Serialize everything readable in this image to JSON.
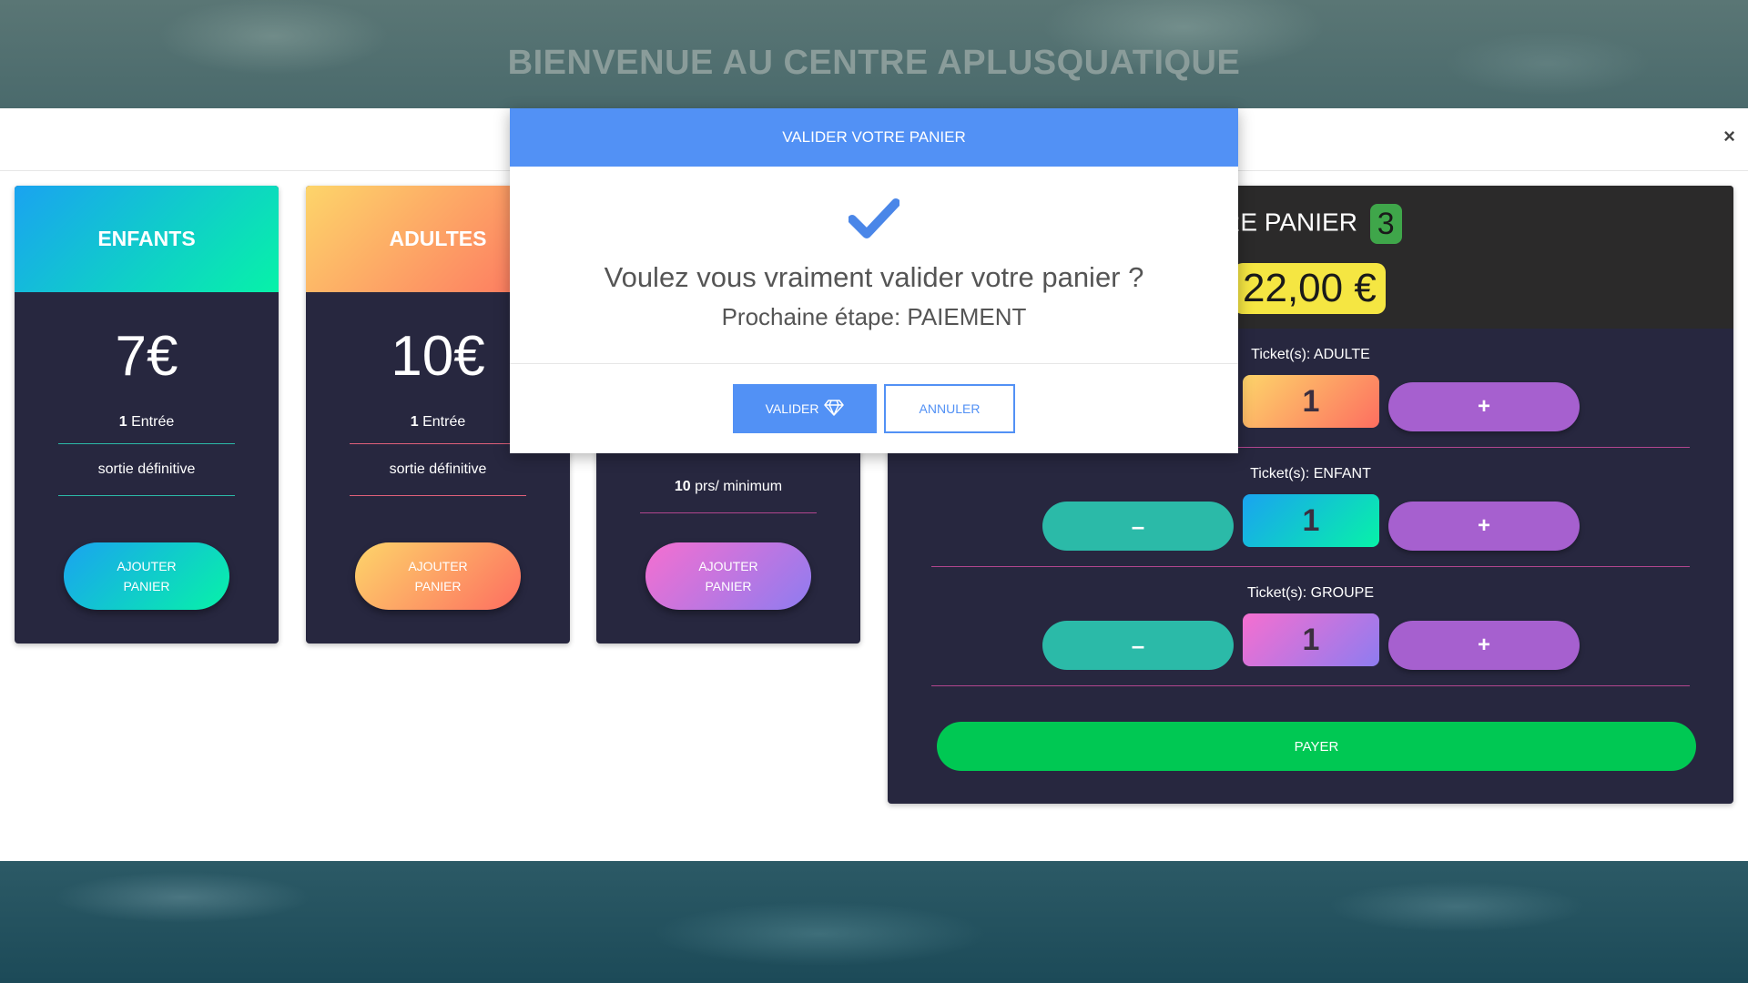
{
  "site": {
    "title": "BIENVENUE AU CENTRE APLUSQUATIQUE"
  },
  "modal": {
    "close_label": "×"
  },
  "cards": [
    {
      "title": "ENFANTS",
      "price": "7€",
      "line1_bold": "1",
      "line1_rest": " Entrée",
      "line2": "sortie définitive",
      "button": "AJOUTER PANIER"
    },
    {
      "title": "ADULTES",
      "price": "10€",
      "line1_bold": "1",
      "line1_rest": " Entrée",
      "line2": "sortie définitive",
      "button": "AJOUTER PANIER"
    },
    {
      "title": "",
      "price": "",
      "line1_bold": "",
      "line1_rest": "",
      "line2_bold": "10",
      "line2_rest": " prs/ minimum",
      "button": "AJOUTER PANIER"
    }
  ],
  "cart": {
    "title_visible": "TRE PANIER",
    "count": "3",
    "total": "22,00 €",
    "rows": [
      {
        "label": "Ticket(s): ADULTE",
        "minus": "–",
        "qty": "1",
        "plus": "+"
      },
      {
        "label": "Ticket(s): ENFANT",
        "minus": "–",
        "qty": "1",
        "plus": "+"
      },
      {
        "label": "Ticket(s): GROUPE",
        "minus": "–",
        "qty": "1",
        "plus": "+"
      }
    ],
    "pay_label": "PAYER"
  },
  "dialog": {
    "title": "VALIDER VOTRE PANIER",
    "question": "Voulez vous vraiment valider votre panier ?",
    "subtitle": "Prochaine étape: PAIEMENT",
    "confirm_label": "VALIDER",
    "cancel_label": "ANNULER",
    "icons": {
      "check": "check-icon",
      "diamond": "diamond-icon"
    }
  },
  "colors": {
    "accent_blue": "#5291f5",
    "card_bg": "#27273f",
    "pay_green": "#00c853",
    "badge_green": "#3fa64a",
    "total_yellow": "#f5e642",
    "plus_purple": "#a660cf",
    "minus_teal": "#2bbaa8"
  }
}
